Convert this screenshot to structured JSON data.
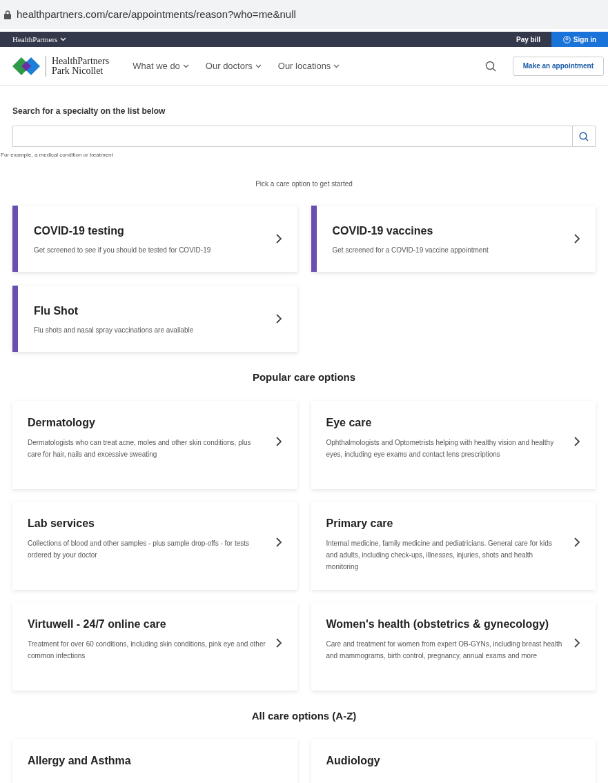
{
  "address_bar": {
    "url": "healthpartners.com/care/appointments/reason?who=me&null"
  },
  "top_bar": {
    "brand": "HealthPartners",
    "pay_bill": "Pay bill",
    "sign_in": "Sign in"
  },
  "nav": {
    "logo_line_1": "HealthPartners",
    "logo_line_2": "Park Nicollet",
    "items": [
      "What we do",
      "Our doctors",
      "Our locations"
    ],
    "appointment_button": "Make an appointment"
  },
  "search": {
    "label": "Search for a specialty on the list below",
    "hint": "For example, a medical condition or treatment"
  },
  "intro": "Pick a care option to get started",
  "featured_options": [
    {
      "title": "COVID-19 testing",
      "description": "Get screened to see if you should be tested for COVID-19"
    },
    {
      "title": "COVID-19 vaccines",
      "description": "Get screened for a COVID-19 vaccine appointment"
    },
    {
      "title": "Flu Shot",
      "description": "Flu shots and nasal spray vaccinations are available"
    }
  ],
  "popular_heading": "Popular care options",
  "popular_options": [
    {
      "title": "Dermatology",
      "description": "Dermatologists who can treat acne, moles and other skin conditions, plus care for hair, nails and excessive sweating"
    },
    {
      "title": "Eye care",
      "description": "Ophthalmologists and Optometrists helping with healthy vision and healthy eyes, including eye exams and contact lens prescriptions"
    },
    {
      "title": "Lab services",
      "description": "Collections of blood and other samples - plus sample drop-offs - for tests ordered by your doctor"
    },
    {
      "title": "Primary care",
      "description": "Internal medicine, family medicine and pediatricians. General care for kids and adults, including check-ups, illnesses, injuries, shots and health monitoring"
    },
    {
      "title": "Virtuwell - 24/7 online care",
      "description": "Treatment for over 60 conditions, including skin conditions, pink eye and other common infections"
    },
    {
      "title": "Women's health (obstetrics & gynecology)",
      "description": "Care and treatment for women from expert OB-GYNs, including breast health and mammograms, birth control, pregnancy, annual exams and more"
    }
  ],
  "all_heading": "All care options (A-Z)",
  "all_options": [
    {
      "title": "Allergy and Asthma"
    },
    {
      "title": "Audiology"
    }
  ]
}
